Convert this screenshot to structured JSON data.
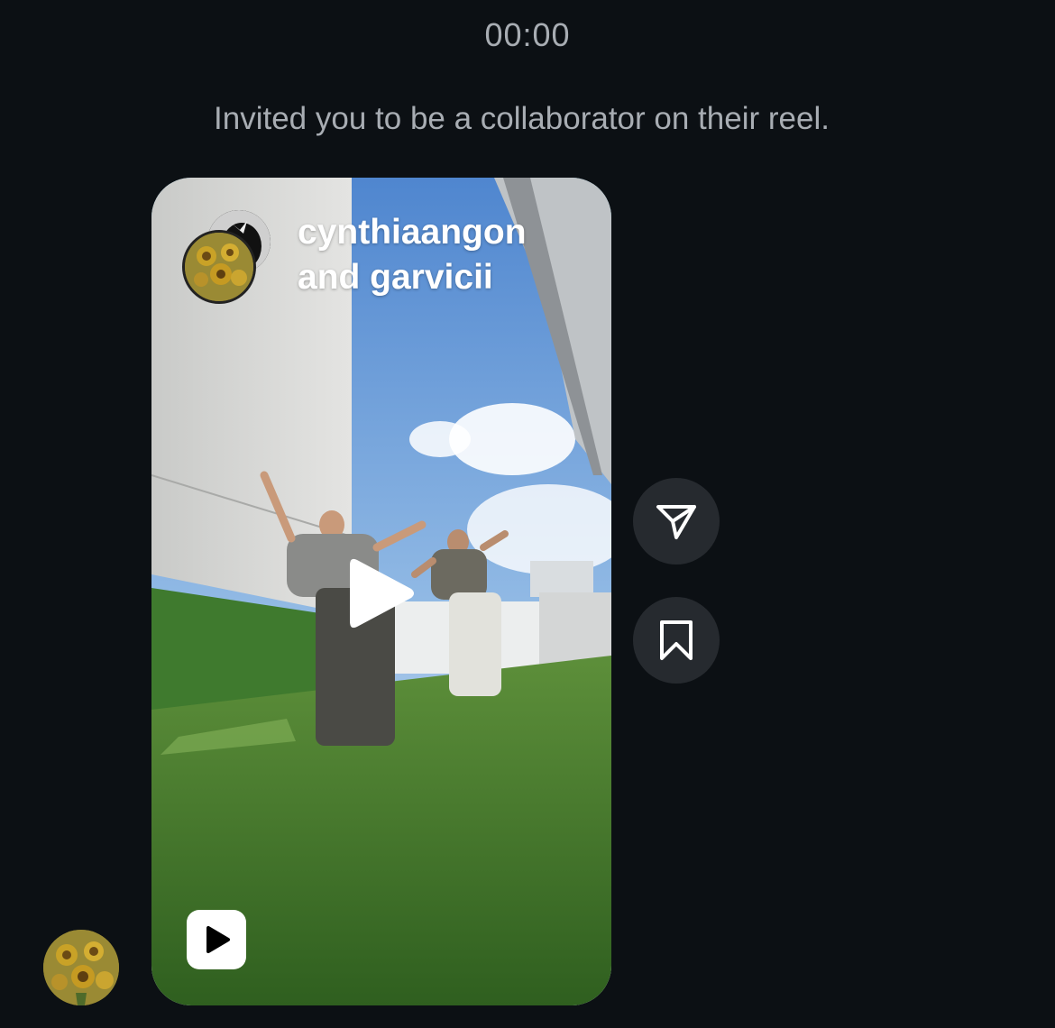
{
  "thread": {
    "timestamp": "00:00",
    "notice": "Invited you to be a collaborator on their reel."
  },
  "reel": {
    "collaborators_line1": "cynthiaangon",
    "collaborators_line2": "and garvicii",
    "media_icon": "play-icon",
    "type_badge_icon": "reels-icon"
  },
  "actions": {
    "share_icon": "share-icon",
    "save_icon": "bookmark-icon"
  },
  "sender": {
    "avatar_icon": "sunflower-avatar"
  },
  "colors": {
    "background": "#0c1014",
    "muted_text": "#a8adb3",
    "action_button_bg": "#262a2f",
    "white": "#ffffff"
  }
}
